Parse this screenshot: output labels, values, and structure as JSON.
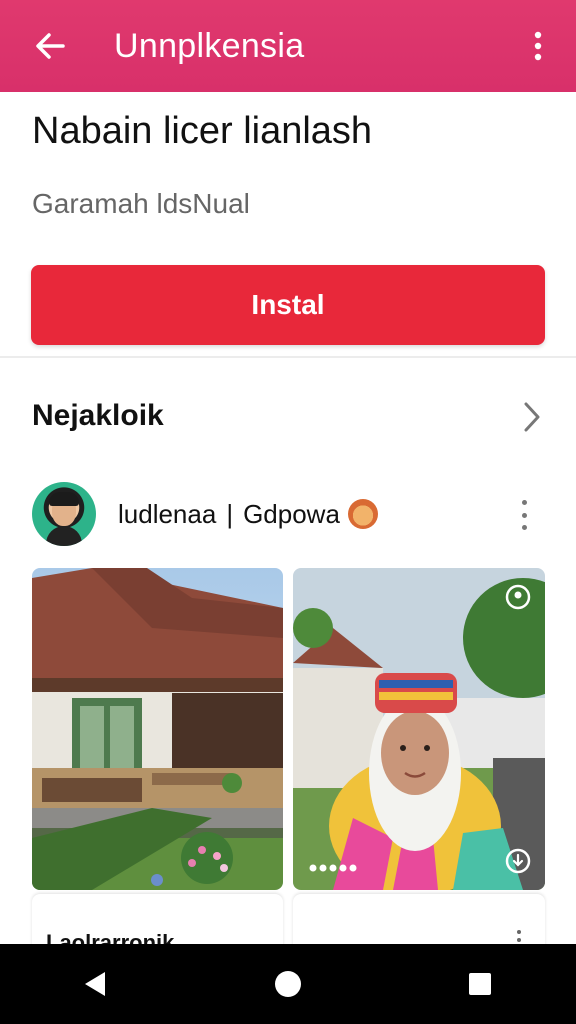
{
  "appbar": {
    "title": "Unnplkensia",
    "back_icon": "arrow-left-icon",
    "more_icon": "more-vertical-icon",
    "color": "#dc336b"
  },
  "app": {
    "name": "Nabain licer lianlash",
    "developer": "Garamah ldsNual",
    "install_label": "Instal",
    "install_color": "#e8283a"
  },
  "section": {
    "title": "Nejakloik",
    "chevron_icon": "chevron-right-icon"
  },
  "post": {
    "author": "ludlenaa",
    "separator": "|",
    "handle": "Gdpowa",
    "emoji_icon": "face-emoji-icon",
    "more_icon": "more-vertical-icon"
  },
  "cards": [
    {
      "image": "traditional-house-photo",
      "label": "Laolrarronik"
    },
    {
      "image": "woman-portrait-photo",
      "label": "",
      "pin_icon": "location-pin-icon",
      "download_icon": "download-icon"
    }
  ],
  "navbar": {
    "back_icon": "nav-back-icon",
    "home_icon": "nav-home-icon",
    "recents_icon": "nav-recents-icon"
  }
}
